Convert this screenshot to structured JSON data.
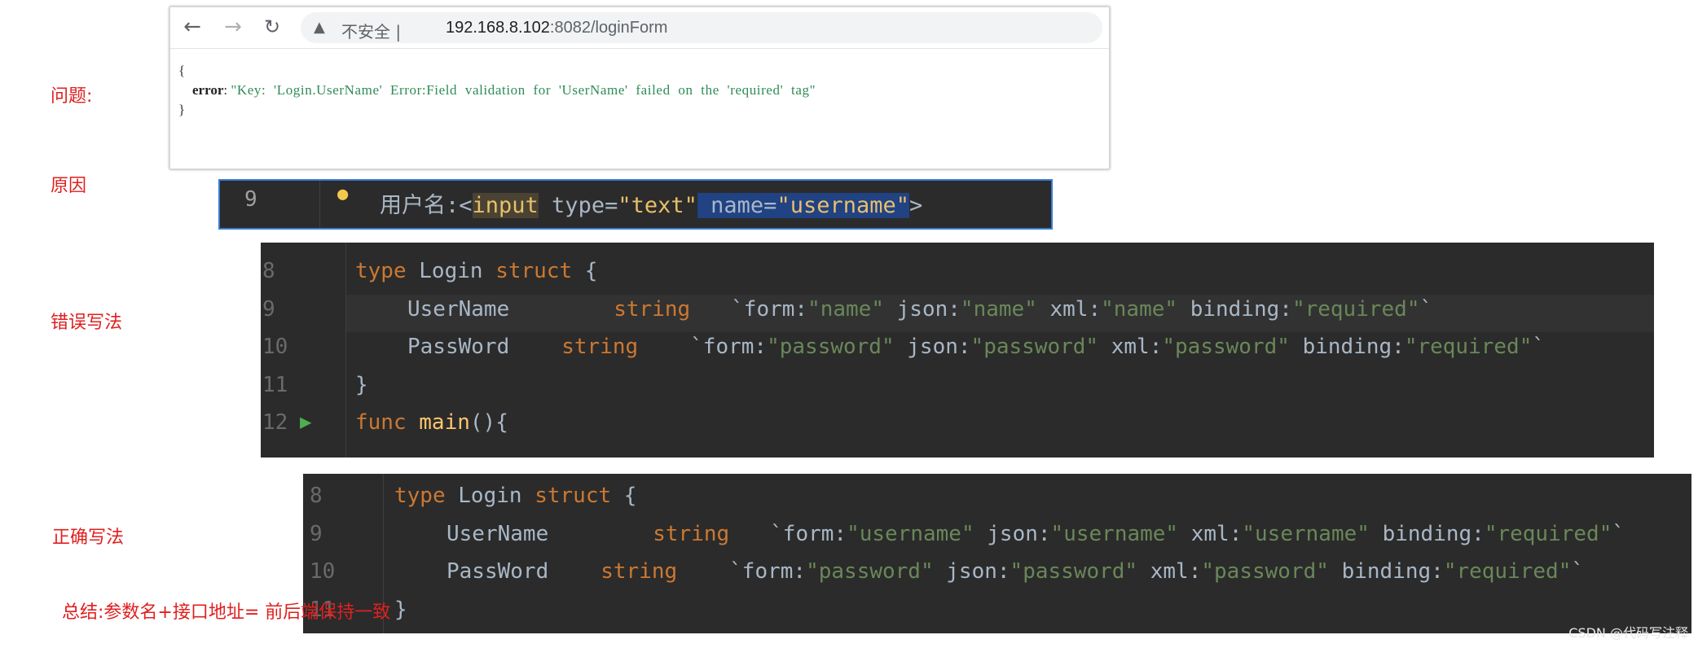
{
  "labels": {
    "problem": "问题:",
    "cause": "原因",
    "wrong": "错误写法",
    "correct": "正确写法",
    "summary": "总结:参数名+接口地址= 前后端保持一致"
  },
  "browser": {
    "insecure": "不安全 |",
    "url_host": "192.168.8.102",
    "url_rest": ":8082/loginForm",
    "json_open": "{",
    "error_key": "error",
    "error_value": "\"Key:  'Login.UserName'  Error:Field  validation  for  'UserName'  failed  on  the  'required'  tag\"",
    "json_close": "}"
  },
  "cause_code": {
    "line_no": "9",
    "prefix": "用户名:<",
    "tag": "input",
    "attr1": " type=",
    "val1": "\"text\"",
    "attr2": " name=",
    "val2": "\"username\"",
    "suffix": ">"
  },
  "wrong_code": {
    "lines": [
      {
        "no": "8",
        "a": "type",
        "b": " Login ",
        "c": "struct",
        "d": " {"
      },
      {
        "no": "9",
        "field": "UserName",
        "type": "string",
        "form": "\"name\"",
        "json": "\"name\"",
        "xml": "\"name\"",
        "binding": "\"required\""
      },
      {
        "no": "10",
        "field": "PassWord",
        "type": "string",
        "form": "\"password\"",
        "json": "\"password\"",
        "xml": "\"password\"",
        "binding": "\"required\""
      },
      {
        "no": "11",
        "text": "}"
      },
      {
        "no": "12",
        "a": "func",
        "b": " main",
        "c": "(){"
      }
    ]
  },
  "correct_code": {
    "lines": [
      {
        "no": "8",
        "a": "type",
        "b": " Login ",
        "c": "struct",
        "d": " {"
      },
      {
        "no": "9",
        "field": "UserName",
        "type": "string",
        "form": "\"username\"",
        "json": "\"username\"",
        "xml": "\"username\"",
        "binding": "\"required\""
      },
      {
        "no": "10",
        "field": "PassWord",
        "type": "string",
        "form": "\"password\"",
        "json": "\"password\"",
        "xml": "\"password\"",
        "binding": "\"required\""
      },
      {
        "no": "11",
        "text": "}"
      }
    ]
  },
  "tags": {
    "form": "`form:",
    "json": " json:",
    "xml": " xml:",
    "binding": " binding:",
    "end": "`"
  },
  "watermark": "CSDN @代码写注释"
}
